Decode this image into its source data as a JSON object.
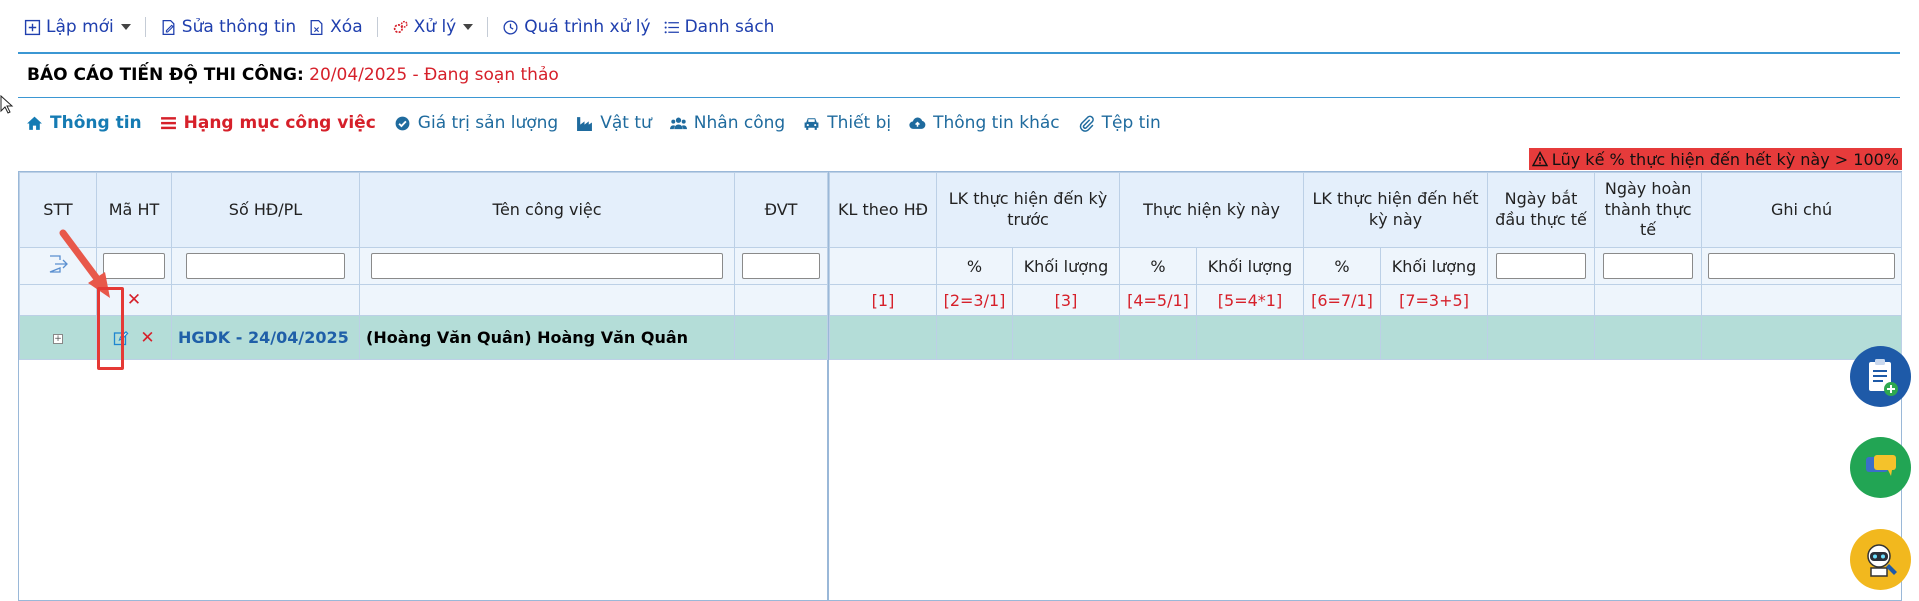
{
  "toolbar": {
    "new_label": "Lập mới",
    "edit_label": "Sửa thông tin",
    "delete_label": "Xóa",
    "process_label": "Xử lý",
    "history_label": "Quá trình xử lý",
    "list_label": "Danh sách"
  },
  "title": {
    "label": "BÁO CÁO TIẾN ĐỘ THI CÔNG:",
    "value": "20/04/2025 - Đang soạn thảo"
  },
  "tabs": [
    {
      "label": "Thông tin",
      "icon": "home-icon"
    },
    {
      "label": "Hạng mục công việc",
      "icon": "list-icon"
    },
    {
      "label": "Giá trị sản lượng",
      "icon": "check-circle-icon"
    },
    {
      "label": "Vật tư",
      "icon": "factory-icon"
    },
    {
      "label": "Nhân công",
      "icon": "users-icon"
    },
    {
      "label": "Thiết bị",
      "icon": "car-icon"
    },
    {
      "label": "Thông tin khác",
      "icon": "cloud-icon"
    },
    {
      "label": "Tệp tin",
      "icon": "paperclip-icon"
    }
  ],
  "warning": "Lũy kế % thực hiện đến hết kỳ này > 100%",
  "left_grid": {
    "headers": [
      "STT",
      "Mã HT",
      "Số HĐ/PL",
      "Tên công việc",
      "ĐVT"
    ],
    "row": {
      "code": "HGDK - 24/04/2025",
      "name": "(Hoàng Văn Quân) Hoàng Văn Quân"
    }
  },
  "right_grid": {
    "headers": [
      "KL theo HĐ",
      "LK thực hiện đến kỳ trước",
      "Thực hiện kỳ này",
      "LK thực hiện đến hết kỳ này",
      "Ngày bắt đầu thực tế",
      "Ngày hoàn thành thực tế",
      "Ghi chú"
    ],
    "sub_headers": [
      "%",
      "Khối lượng",
      "%",
      "Khối lượng",
      "%",
      "Khối lượng"
    ],
    "formulas": [
      "[1]",
      "[2=3/1]",
      "[3]",
      "[4=5/1]",
      "[5=4*1]",
      "[6=7/1]",
      "[7=3+5]"
    ]
  },
  "colors": {
    "accent": "#3b97d3",
    "row_highlight": "#b4ddd8",
    "header_bg": "#e4effb",
    "warning_bg": "#e63b3b",
    "red_text": "#d6202a"
  }
}
